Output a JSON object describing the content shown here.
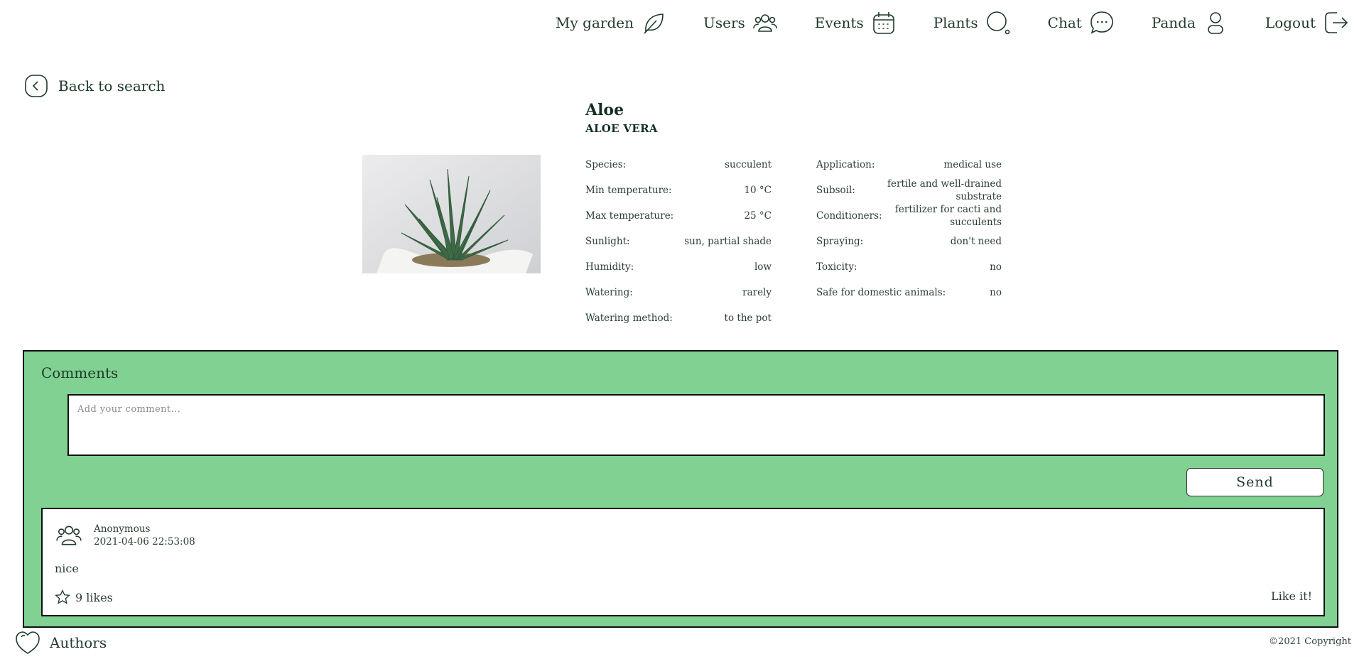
{
  "nav": {
    "items": [
      {
        "label": "My garden",
        "icon": "leaf-icon"
      },
      {
        "label": "Users",
        "icon": "users-icon"
      },
      {
        "label": "Events",
        "icon": "calendar-icon"
      },
      {
        "label": "Plants",
        "icon": "search-icon"
      },
      {
        "label": "Chat",
        "icon": "chat-icon"
      },
      {
        "label": "Panda",
        "icon": "user-icon"
      },
      {
        "label": "Logout",
        "icon": "logout-icon"
      }
    ]
  },
  "back": {
    "label": "Back to search",
    "icon": "chevron-left-icon"
  },
  "plant": {
    "name": "Aloe",
    "latin_name": "ALOE VERA",
    "image": "aloe-vera-photo",
    "properties_left": [
      {
        "label": "Species:",
        "value": "succulent"
      },
      {
        "label": "Min temperature:",
        "value": "10 °C"
      },
      {
        "label": "Max temperature:",
        "value": "25 °C"
      },
      {
        "label": "Sunlight:",
        "value": "sun, partial shade"
      },
      {
        "label": "Humidity:",
        "value": "low"
      },
      {
        "label": "Watering:",
        "value": "rarely"
      },
      {
        "label": "Watering method:",
        "value": "to the pot"
      }
    ],
    "properties_right": [
      {
        "label": "Application:",
        "value": "medical use"
      },
      {
        "label": "Subsoil:",
        "value": "fertile and well-drained substrate"
      },
      {
        "label": "Conditioners:",
        "value": "fertilizer for cacti and succulents"
      },
      {
        "label": "Spraying:",
        "value": "don't need"
      },
      {
        "label": "Toxicity:",
        "value": "no"
      },
      {
        "label": "Safe for domestic animals:",
        "value": "no"
      }
    ]
  },
  "comments": {
    "title": "Comments",
    "input_placeholder": "Add your comment...",
    "send_label": "Send",
    "background": "#80d192",
    "items": [
      {
        "author": "Anonymous",
        "date": "2021-04-06 22:53:08",
        "text": "nice",
        "likes": "9 likes",
        "like_label": "Like it!"
      }
    ]
  },
  "footer": {
    "authors_label": "Authors",
    "authors_icon": "heart-icon",
    "copyright": "©2021 Copyright"
  }
}
